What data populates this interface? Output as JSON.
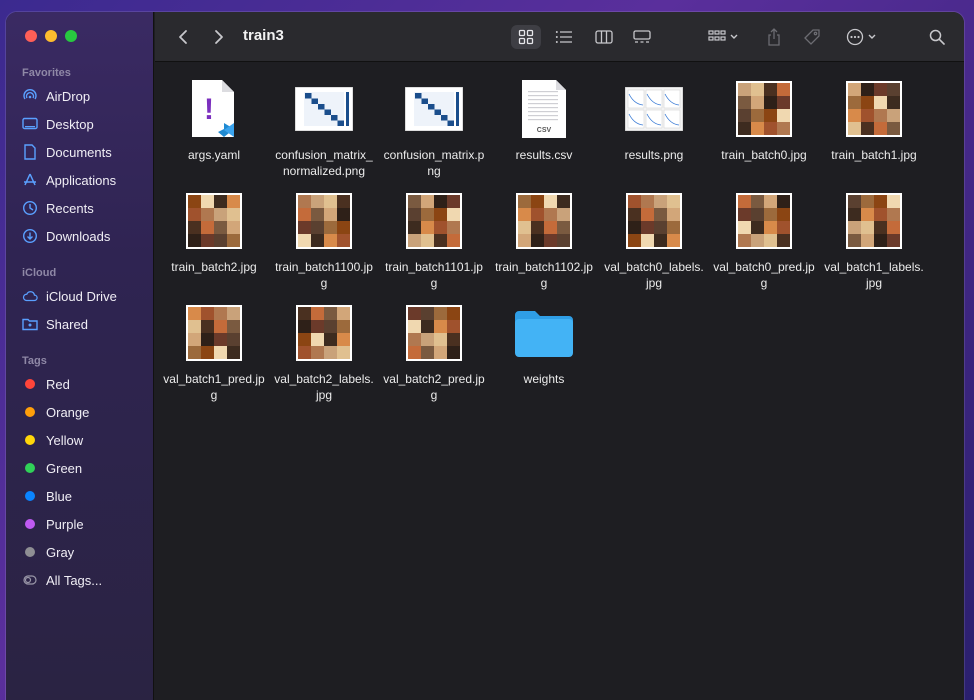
{
  "window": {
    "title": "train3"
  },
  "colors": {
    "close": "#ff5f57",
    "minimize": "#febc2e",
    "maximize": "#28c840",
    "accent": "#3b8eea"
  },
  "sidebar": {
    "favorites_label": "Favorites",
    "favorites": [
      {
        "label": "AirDrop",
        "icon": "airdrop-icon"
      },
      {
        "label": "Desktop",
        "icon": "desktop-icon"
      },
      {
        "label": "Documents",
        "icon": "document-icon"
      },
      {
        "label": "Applications",
        "icon": "applications-icon"
      },
      {
        "label": "Recents",
        "icon": "clock-icon"
      },
      {
        "label": "Downloads",
        "icon": "download-icon"
      }
    ],
    "icloud_label": "iCloud",
    "icloud": [
      {
        "label": "iCloud Drive",
        "icon": "cloud-icon"
      },
      {
        "label": "Shared",
        "icon": "shared-folder-icon"
      }
    ],
    "tags_label": "Tags",
    "tags": [
      {
        "label": "Red",
        "color": "#ff453a"
      },
      {
        "label": "Orange",
        "color": "#ff9f0a"
      },
      {
        "label": "Yellow",
        "color": "#ffd60a"
      },
      {
        "label": "Green",
        "color": "#30d158"
      },
      {
        "label": "Blue",
        "color": "#0a84ff"
      },
      {
        "label": "Purple",
        "color": "#bf5af2"
      },
      {
        "label": "Gray",
        "color": "#8e8e93"
      },
      {
        "label": "All Tags...",
        "color": ""
      }
    ]
  },
  "files": [
    {
      "name": "args.yaml",
      "kind": "yaml"
    },
    {
      "name": "confusion_matrix_normalized.png",
      "kind": "matrix"
    },
    {
      "name": "confusion_matrix.png",
      "kind": "matrix"
    },
    {
      "name": "results.csv",
      "kind": "csv",
      "badge": "CSV"
    },
    {
      "name": "results.png",
      "kind": "plots"
    },
    {
      "name": "train_batch0.jpg",
      "kind": "photo"
    },
    {
      "name": "train_batch1.jpg",
      "kind": "photo"
    },
    {
      "name": "train_batch2.jpg",
      "kind": "photo"
    },
    {
      "name": "train_batch1100.jpg",
      "kind": "photo"
    },
    {
      "name": "train_batch1101.jpg",
      "kind": "photo"
    },
    {
      "name": "train_batch1102.jpg",
      "kind": "photo"
    },
    {
      "name": "val_batch0_labels.jpg",
      "kind": "photo"
    },
    {
      "name": "val_batch0_pred.jpg",
      "kind": "photo"
    },
    {
      "name": "val_batch1_labels.jpg",
      "kind": "photo"
    },
    {
      "name": "val_batch1_pred.jpg",
      "kind": "photo"
    },
    {
      "name": "val_batch2_labels.jpg",
      "kind": "photo"
    },
    {
      "name": "val_batch2_pred.jpg",
      "kind": "photo"
    },
    {
      "name": "weights",
      "kind": "folder"
    }
  ]
}
